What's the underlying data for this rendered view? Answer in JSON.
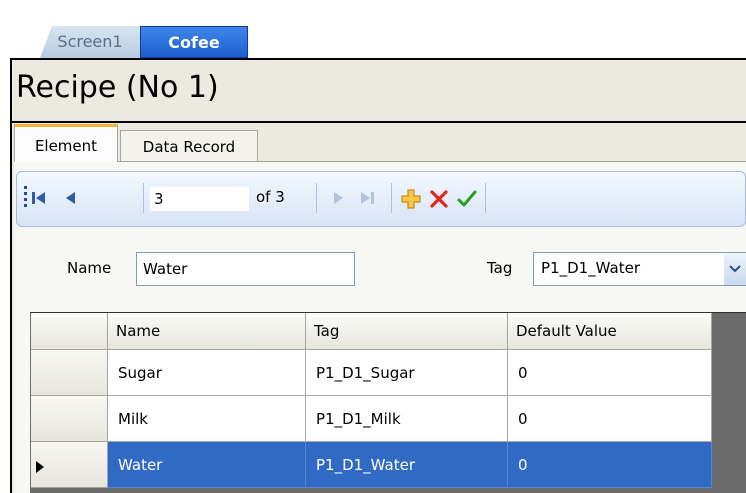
{
  "outer_tabs": [
    {
      "label": "Screen1",
      "active": false
    },
    {
      "label": "Cofee",
      "active": true
    }
  ],
  "title": "Recipe (No 1)",
  "inner_tabs": [
    {
      "label": "Element",
      "active": true
    },
    {
      "label": "Data Record",
      "active": false
    }
  ],
  "navigator": {
    "position": "3",
    "of_count": "of 3",
    "icons": [
      "move-first-icon",
      "move-previous-icon",
      "move-next-icon",
      "move-last-icon",
      "add-icon",
      "delete-icon",
      "save-icon"
    ]
  },
  "form": {
    "name_label": "Name",
    "name_value": "Water",
    "tag_label": "Tag",
    "tag_value": "P1_D1_Water"
  },
  "grid": {
    "columns": [
      "Name",
      "Tag",
      "Default Value"
    ],
    "rows": [
      {
        "name": "Sugar",
        "tag": "P1_D1_Sugar",
        "default": "0",
        "selected": false
      },
      {
        "name": "Milk",
        "tag": "P1_D1_Milk",
        "default": "0",
        "selected": false
      },
      {
        "name": "Water",
        "tag": "P1_D1_Water",
        "default": "0",
        "selected": true
      }
    ]
  },
  "colors": {
    "active_tab": "#1c5fd0",
    "selection": "#316ac5",
    "add_icon": "#e6a21d",
    "delete_icon": "#e0261b",
    "save_icon": "#27a020"
  }
}
